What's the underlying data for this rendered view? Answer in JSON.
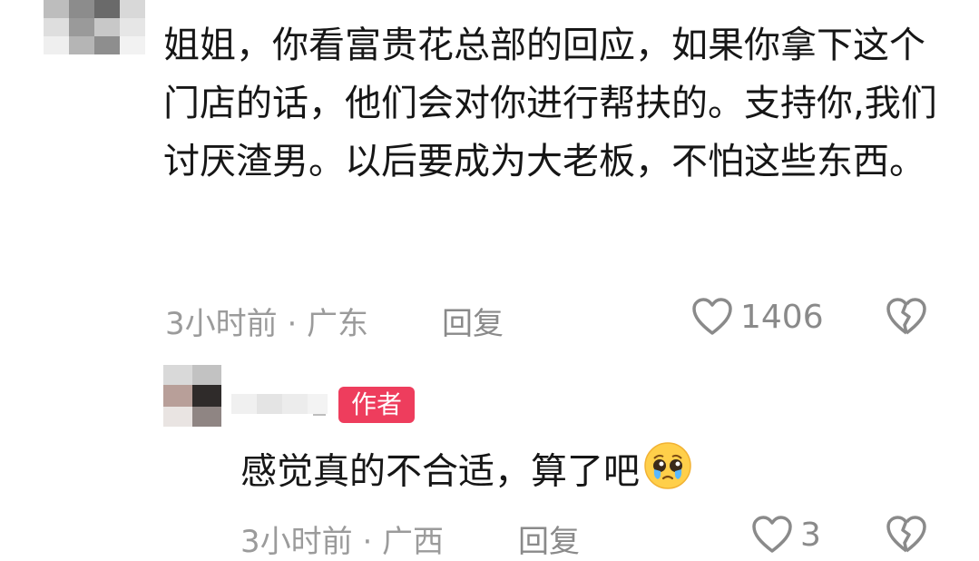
{
  "comment": {
    "text": "姐姐，你看富贵花总部的回应，如果你拿下这个门店的话，他们会对你进行帮扶的。支持你,我们讨厌渣男。以后要成为大老板，不怕这些东西。",
    "time_location": "3小时前 · 广东",
    "reply_label": "回复",
    "like_count": "1406"
  },
  "reply": {
    "badge": "作者",
    "text": "感觉真的不合适，算了吧",
    "emoji": "pleading-face-with-tears",
    "time_location": "3小时前 · 广西",
    "reply_label": "回复",
    "like_count": "3"
  },
  "icons": {
    "like": "heart-outline-icon",
    "dislike": "broken-heart-icon"
  },
  "colors": {
    "badge_bg": "#ee3d5d",
    "text": "#161616",
    "meta": "#9b9b9b"
  }
}
